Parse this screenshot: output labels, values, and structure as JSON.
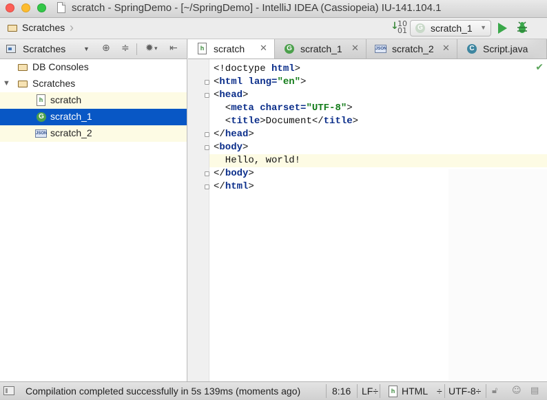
{
  "window": {
    "title": "scratch - SpringDemo - [~/SpringDemo] - IntelliJ IDEA (Cassiopeia) IU-141.104.1"
  },
  "navbar": {
    "breadcrumb": "Scratches",
    "run_config": "scratch_1",
    "run_config_icon": "G"
  },
  "project_panel": {
    "title": "Scratches",
    "tree": [
      {
        "label": "DB Consoles",
        "icon": "folder-icon"
      },
      {
        "label": "Scratches",
        "icon": "folder-icon",
        "expanded": true
      },
      {
        "label": "scratch",
        "icon": "html-file-icon"
      },
      {
        "label": "scratch_1",
        "icon": "groovy-file-icon",
        "selected": true
      },
      {
        "label": "scratch_2",
        "icon": "json-file-icon"
      }
    ]
  },
  "tabs": [
    {
      "label": "scratch",
      "icon": "html-file-icon",
      "active": true
    },
    {
      "label": "scratch_1",
      "icon": "groovy-file-icon"
    },
    {
      "label": "scratch_2",
      "icon": "json-file-icon"
    },
    {
      "label": "Script.java",
      "icon": "class-file-icon"
    }
  ],
  "editor": {
    "lines": [
      {
        "tokens": [
          {
            "t": "<!doctype "
          },
          {
            "t": "html",
            "c": "kw"
          },
          {
            "t": ">"
          }
        ]
      },
      {
        "tokens": [
          {
            "t": "<"
          },
          {
            "t": "html ",
            "c": "kw"
          },
          {
            "t": "lang=",
            "c": "at"
          },
          {
            "t": "\"en\"",
            "c": "st"
          },
          {
            "t": ">"
          }
        ]
      },
      {
        "tokens": [
          {
            "t": "<"
          },
          {
            "t": "head",
            "c": "kw"
          },
          {
            "t": ">"
          }
        ]
      },
      {
        "tokens": [
          {
            "t": "  <"
          },
          {
            "t": "meta ",
            "c": "kw"
          },
          {
            "t": "charset=",
            "c": "at"
          },
          {
            "t": "\"UTF-8\"",
            "c": "st"
          },
          {
            "t": ">"
          }
        ]
      },
      {
        "tokens": [
          {
            "t": "  <"
          },
          {
            "t": "title",
            "c": "kw"
          },
          {
            "t": ">Document</"
          },
          {
            "t": "title",
            "c": "kw"
          },
          {
            "t": ">"
          }
        ]
      },
      {
        "tokens": [
          {
            "t": "</"
          },
          {
            "t": "head",
            "c": "kw"
          },
          {
            "t": ">"
          }
        ]
      },
      {
        "tokens": [
          {
            "t": "<"
          },
          {
            "t": "body",
            "c": "kw"
          },
          {
            "t": ">"
          }
        ]
      },
      {
        "tokens": [
          {
            "t": "  Hello, world!"
          }
        ]
      },
      {
        "tokens": [
          {
            "t": "</"
          },
          {
            "t": "body",
            "c": "kw"
          },
          {
            "t": ">"
          }
        ]
      },
      {
        "tokens": [
          {
            "t": "</"
          },
          {
            "t": "html",
            "c": "kw"
          },
          {
            "t": ">"
          }
        ]
      }
    ]
  },
  "status_bar": {
    "message": "Compilation completed successfully in 5s 139ms (moments ago)",
    "position": "8:16",
    "line_separator": "LF÷",
    "language": "HTML",
    "language_arrow": "÷",
    "encoding": "UTF-8÷"
  },
  "colors": {
    "selection": "#0857c5",
    "caret_row": "#fdfbe4",
    "keyword": "#0b2e8a",
    "string": "#137c1a"
  }
}
